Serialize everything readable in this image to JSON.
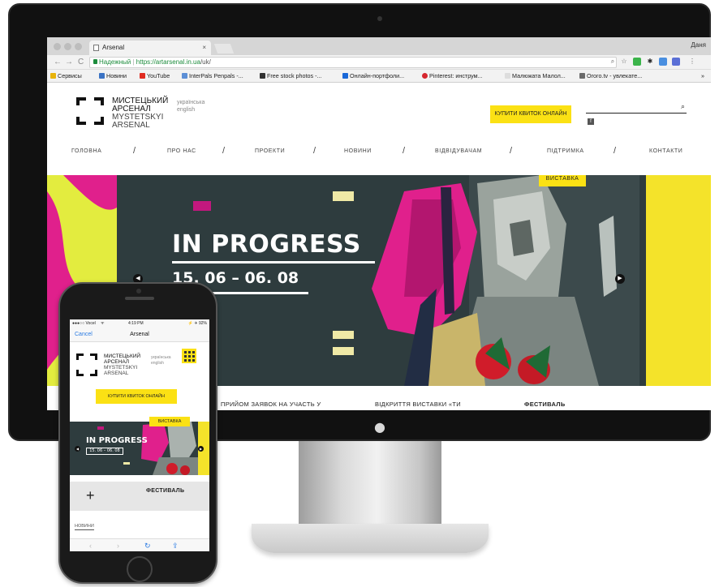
{
  "browser": {
    "tab_title": "Arsenal",
    "tab_close": "×",
    "user": "Даня",
    "secure_label": "Надежный",
    "url_host": "https://artarsenal.in.ua",
    "url_path": "/uk/",
    "back": "←",
    "forward": "→",
    "reload": "C",
    "bookmarks": [
      {
        "label": "Сервисы",
        "color": "#e8b30a"
      },
      {
        "label": "Новини",
        "color": "#3b73c4"
      },
      {
        "label": "YouTube",
        "color": "#e02b20"
      },
      {
        "label": "InterPals Penpals -...",
        "color": "#5c8fd6"
      },
      {
        "label": "Free stock photos -...",
        "color": "#333333"
      },
      {
        "label": "Онлайн-портфоли...",
        "color": "#1a68d8"
      },
      {
        "label": "Pinterest: инструм...",
        "color": "#d6262e"
      },
      {
        "label": "Малюжата Малол...",
        "color": "#dddddd"
      },
      {
        "label": "Огого.tv - увлекате...",
        "color": "#6a6a6a"
      }
    ],
    "more": "»"
  },
  "site": {
    "logo_line1": "МИСТЕЦЬКИЙ",
    "logo_line2": "АРСЕНАЛ",
    "logo_line3": "MYSTETSKYI",
    "logo_line4": "ARSENAL",
    "lang_ua": "українська",
    "lang_en": "english",
    "ticket_button": "КУПИТИ КВИТОК ОНЛАЙН",
    "nav": [
      "ГОЛОВНА",
      "ПРО НАС",
      "ПРОЕКТИ",
      "НОВИНИ",
      "ВІДВІДУВАЧАМ",
      "ПІДТРИМКА",
      "КОНТАКТИ"
    ],
    "hero": {
      "badge": "ВИСТАВКА",
      "title": "IN PROGRESS",
      "dates": "15. 06 – 06. 08"
    },
    "below_hero": [
      "ПРИЙОМ ЗАЯВОК НА УЧАСТЬ У",
      "ВІДКРИТТЯ ВИСТАВКИ «ТИ",
      "ФЕСТИВАЛЬ"
    ]
  },
  "phone": {
    "carrier": "●●●○○ Vocel",
    "wifi": "ᯤ",
    "time": "4:19 PM",
    "battery": "⚡ ✈ 92%",
    "cancel": "Cancel",
    "title": "Arsenal",
    "ticket_button": "КУПИТИ КВИТОК ОНЛАЙН",
    "hero_badge": "ВИСТАВКА",
    "hero_title": "IN PROGRESS",
    "hero_dates": "15. 06 – 06. 08",
    "plus": "+",
    "festival": "ФЕСТИВАЛЬ",
    "news": "НОВИНИ",
    "toolbar": [
      "‹",
      "›",
      "↻",
      "⇪"
    ]
  },
  "colors": {
    "accent_yellow": "#fbe114",
    "hero_bg": "#2e3c3e",
    "secure_green": "#1c8c3c",
    "magenta": "#e0208c"
  }
}
